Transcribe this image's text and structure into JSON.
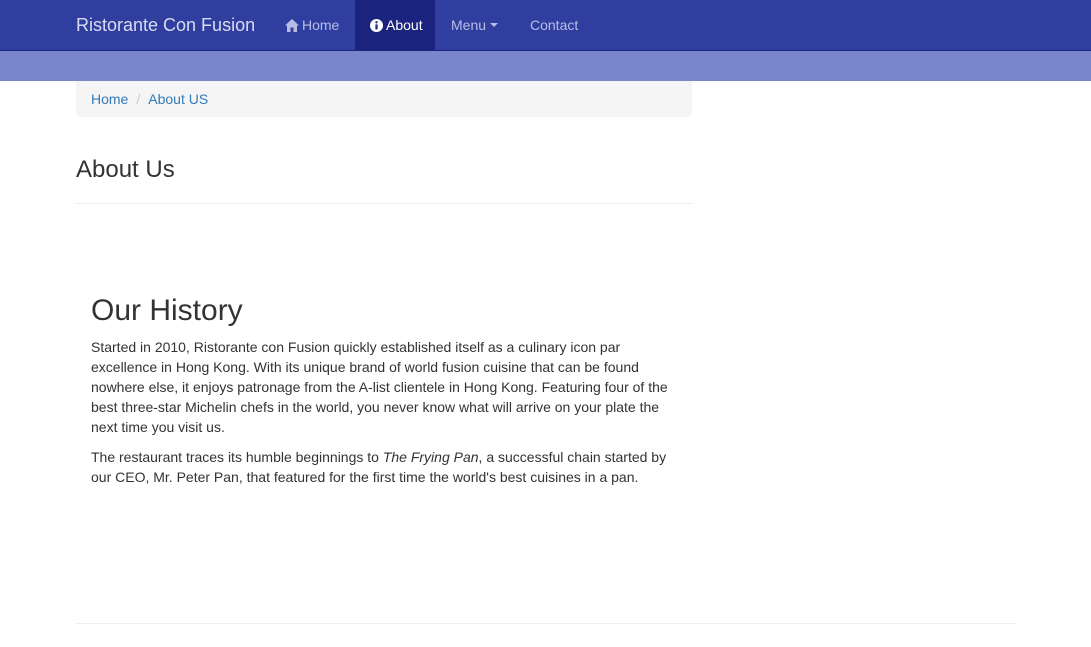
{
  "navbar": {
    "brand": "Ristorante Con Fusion",
    "items": [
      {
        "label": "Home",
        "icon": "home-icon",
        "active": false
      },
      {
        "label": "About",
        "icon": "info-sign-icon",
        "active": true
      },
      {
        "label": "Menu",
        "icon": "caret-down-icon",
        "active": false
      },
      {
        "label": "Contact",
        "active": false
      }
    ]
  },
  "breadcrumb": {
    "items": [
      {
        "label": "Home"
      },
      {
        "label": "About US"
      }
    ],
    "separator": "/"
  },
  "page": {
    "title": "About Us"
  },
  "history": {
    "title": "Our History",
    "paragraph1": "Started in 2010, Ristorante con Fusion quickly established itself as a culinary icon par excellence in Hong Kong. With its unique brand of world fusion cuisine that can be found nowhere else, it enjoys patronage from the A-list clientele in Hong Kong. Featuring four of the best three-star Michelin chefs in the world, you never know what will arrive on your plate the next time you visit us.",
    "paragraph2_before": "The restaurant traces its humble beginnings to ",
    "paragraph2_emphasis": "The Frying Pan",
    "paragraph2_after": ", a successful chain started by our CEO, Mr. Peter Pan, that featured for the first time the world's best cuisines in a pan."
  },
  "colors": {
    "navbar_bg": "#303f9f",
    "navbar_active": "#1a237e",
    "jumbotron_bg": "#7986cb",
    "link": "#337ab7"
  }
}
